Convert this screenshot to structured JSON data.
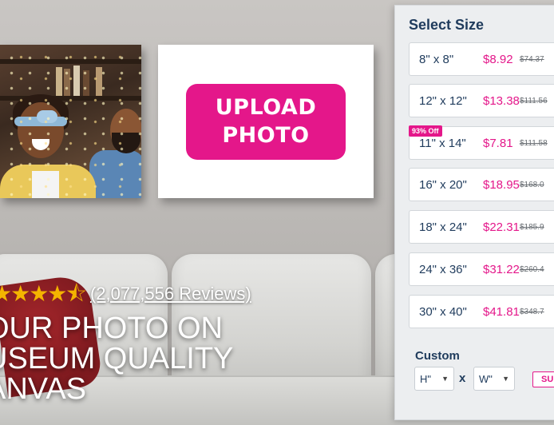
{
  "upload": {
    "label": "UPLOAD\nPHOTO"
  },
  "rating": {
    "stars": "★★★★⯪",
    "reviews": "(2,077,556 Reviews)"
  },
  "headline": {
    "lines": [
      "OUR PHOTO ON",
      "USEUM QUALITY",
      "ANVAS"
    ]
  },
  "panel": {
    "title": "Select Size",
    "badge": "93% Off",
    "sizes": [
      {
        "label": "8\" x 8\"",
        "price": "$8.92",
        "original": "$74.37"
      },
      {
        "label": "12\" x 12\"",
        "price": "$13.38",
        "original": "$111.56"
      },
      {
        "label": "11\" x 14\"",
        "price": "$7.81",
        "original": "$111.58"
      },
      {
        "label": "16\" x 20\"",
        "price": "$18.95",
        "original": "$168.0"
      },
      {
        "label": "18\" x 24\"",
        "price": "$22.31",
        "original": "$185.9"
      },
      {
        "label": "24\" x 36\"",
        "price": "$31.22",
        "original": "$260.4"
      },
      {
        "label": "30\" x 40\"",
        "price": "$41.81",
        "original": "$348.7"
      }
    ],
    "custom": {
      "title": "Custom",
      "height": "H\"",
      "width": "W\"",
      "times": "x",
      "submit": "SU"
    }
  },
  "colors": {
    "accent": "#e4178a",
    "navy": "#1f3b5c",
    "star": "#f4b400"
  }
}
